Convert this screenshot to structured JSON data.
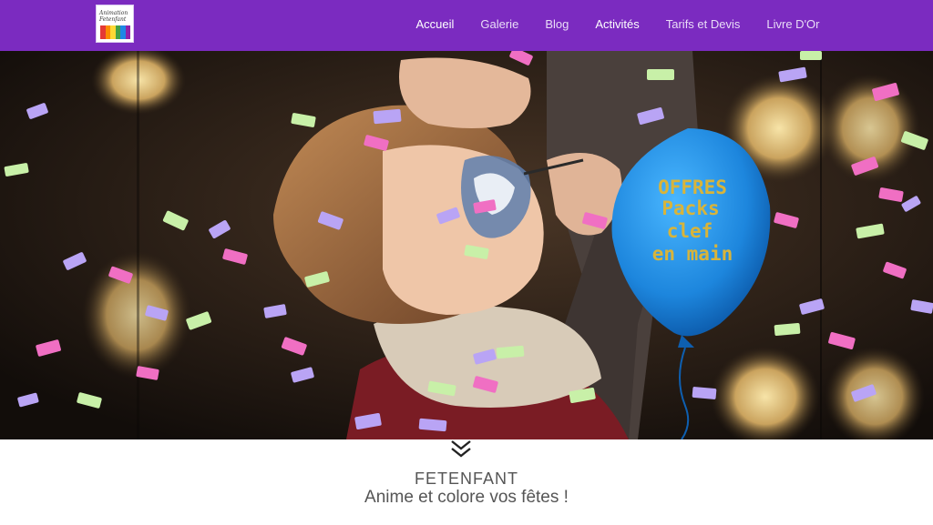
{
  "header": {
    "logo_text": "Animation Fetenfant",
    "logo_stripe_colors": [
      "#e53935",
      "#fb8c00",
      "#fdd835",
      "#43a047",
      "#1e88e5",
      "#8e24aa"
    ],
    "nav": [
      {
        "label": "Accueil",
        "active": true
      },
      {
        "label": "Galerie",
        "active": false
      },
      {
        "label": "Blog",
        "active": false
      },
      {
        "label": "Activités",
        "active": false
      },
      {
        "label": "Tarifs et Devis",
        "active": false
      },
      {
        "label": "Livre D'Or",
        "active": false
      }
    ],
    "bar_color": "#7b2bc0"
  },
  "hero": {
    "balloon": {
      "lines": [
        "OFFRES",
        "Packs",
        "clef",
        "en main"
      ],
      "color": "#1f8ce0",
      "text_color": "#d8b43a"
    },
    "image_subject": "child-face-painting-photo",
    "confetti_colors": [
      "#f06fc3",
      "#b9a4f5",
      "#c8f0a8",
      "#ffffff"
    ]
  },
  "scroll_icon": "double-chevron-down-icon",
  "brand": {
    "name": "FETENFANT",
    "tagline": "Anime et colore vos fêtes !"
  }
}
